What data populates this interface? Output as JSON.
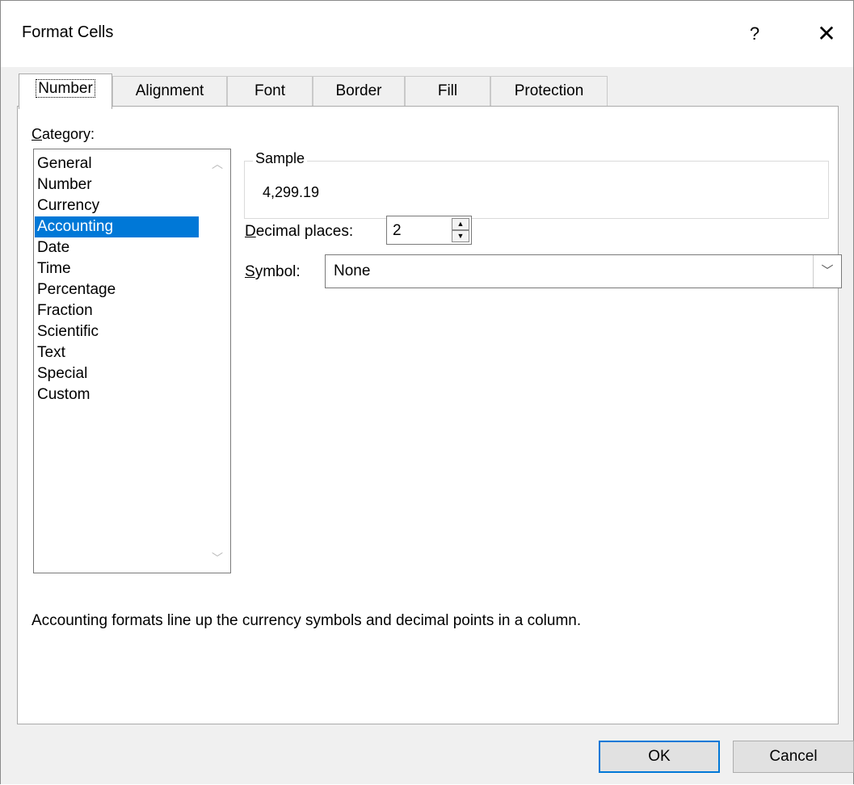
{
  "window": {
    "title": "Format Cells",
    "help_label": "?",
    "close_label": "✕"
  },
  "tabs": [
    {
      "label": "Number",
      "active": true
    },
    {
      "label": "Alignment"
    },
    {
      "label": "Font"
    },
    {
      "label": "Border"
    },
    {
      "label": "Fill"
    },
    {
      "label": "Protection"
    }
  ],
  "category": {
    "label_mnemonic": "C",
    "label_rest": "ategory:",
    "items": [
      "General",
      "Number",
      "Currency",
      "Accounting",
      "Date",
      "Time",
      "Percentage",
      "Fraction",
      "Scientific",
      "Text",
      "Special",
      "Custom"
    ],
    "selected": "Accounting"
  },
  "sample": {
    "legend": "Sample",
    "value": "4,299.19"
  },
  "decimal_places": {
    "label_mnemonic": "D",
    "label_rest": "ecimal places:",
    "value": "2"
  },
  "symbol": {
    "label_mnemonic": "S",
    "label_rest": "ymbol:",
    "value": "None"
  },
  "description": "Accounting formats line up the currency symbols and decimal points in a column.",
  "buttons": {
    "ok": "OK",
    "cancel": "Cancel"
  },
  "colors": {
    "selection": "#0078d7",
    "dialog_background": "#f0f0f0"
  }
}
